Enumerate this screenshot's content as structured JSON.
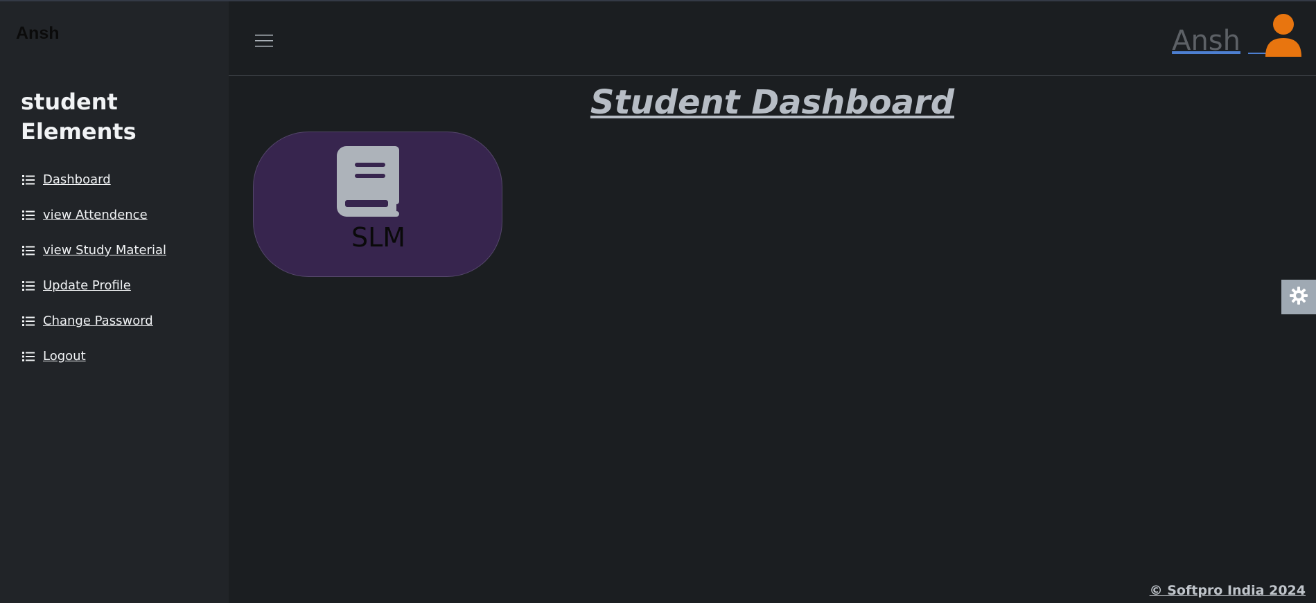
{
  "brand": "Ansh",
  "sidebar": {
    "heading": "student Elements",
    "items": [
      {
        "label": " Dashboard",
        "icon": "list-icon"
      },
      {
        "label": " view Attendence",
        "icon": "list-icon"
      },
      {
        "label": " view Study Material",
        "icon": "list-icon"
      },
      {
        "label": " Update Profile",
        "icon": "list-icon"
      },
      {
        "label": " Change Password",
        "icon": "list-icon"
      },
      {
        "label": " Logout",
        "icon": "list-icon"
      }
    ]
  },
  "header": {
    "menu_icon": "hamburger-icon",
    "user_name": "Ansh",
    "avatar_icon": "user-icon",
    "avatar_color": "#e8750f"
  },
  "main": {
    "title": "Student Dashboard",
    "cards": [
      {
        "label": "SLM",
        "icon": "book-icon",
        "background": "#37254e"
      }
    ]
  },
  "settings_icon": "gear-icon",
  "footer": "© Softpro India 2024"
}
